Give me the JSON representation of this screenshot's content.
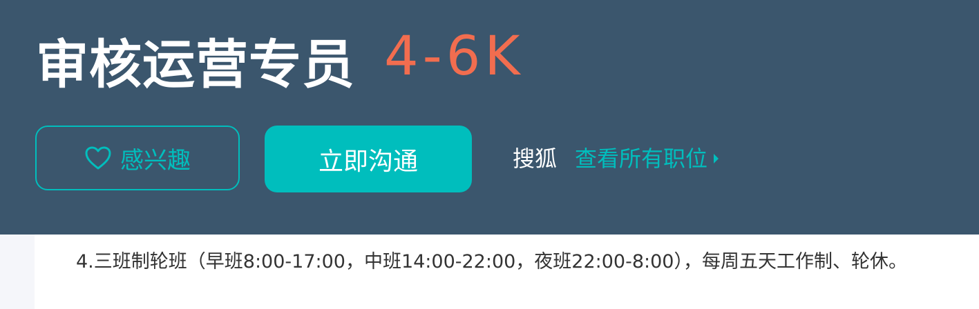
{
  "job": {
    "title": "审核运营专员",
    "salary": "4-6K"
  },
  "actions": {
    "interest_label": "感兴趣",
    "chat_label": "立即沟通"
  },
  "company": {
    "name": "搜狐",
    "view_all_label": "查看所有职位"
  },
  "description": {
    "line": "4.三班制轮班（早班8:00-17:00，中班14:00-22:00，夜班22:00-8:00），每周五天工作制、轮休。"
  },
  "colors": {
    "header_bg": "#3b566d",
    "accent": "#00bebd",
    "salary": "#f26d4f",
    "text": "#333333"
  },
  "icons": {
    "interest": "heart-outline-icon",
    "view_all": "caret-right-icon"
  }
}
